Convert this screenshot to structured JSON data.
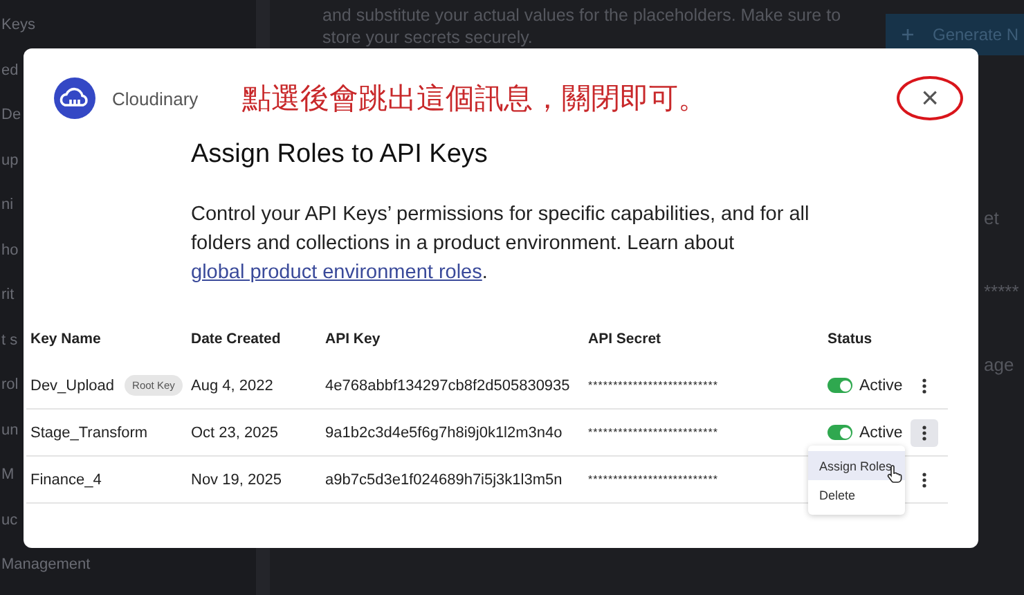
{
  "background": {
    "sidebar": [
      "Keys",
      "ed",
      "De",
      "up",
      "ni",
      "ho",
      "rit",
      "t s",
      "rol",
      "un",
      "M",
      "uc",
      "Management"
    ],
    "notice": [
      "and substitute your actual values for the placeholders. Make sure to",
      "store your secrets securely."
    ],
    "generate_button": "Generate N",
    "right_fragments": [
      "et",
      "*****",
      "age"
    ]
  },
  "dialog": {
    "brand": "Cloudinary",
    "annotation": "點選後會跳出這個訊息，關閉即可。",
    "close": "×",
    "close_circled": true,
    "title": "Assign Roles to API Keys",
    "description": "Control your API Keys’ permissions for specific capabilities, and for all folders and collections in a product environment. Learn about ",
    "link": "global product environment roles",
    "after_link": ".",
    "table": {
      "columns": [
        "Key Name",
        "Date Created",
        "API Key",
        "API Secret",
        "Status"
      ],
      "rows": [
        {
          "name": "Dev_Upload",
          "badge": "Root Key",
          "date": "Aug 4, 2022",
          "key": "4e768abbf134297cb8f2d505830935",
          "secret": "**************************",
          "status": {
            "on": true,
            "label": "Active"
          },
          "menu_open": false
        },
        {
          "name": "Stage_Transform",
          "date": "Oct 23, 2025",
          "key": "9a1b2c3d4e5f6g7h8i9j0k1l2m3n4o",
          "secret": "**************************",
          "status": {
            "on": true,
            "label": "Active"
          },
          "menu_open": true
        },
        {
          "name": "Finance_4",
          "date": "Nov 19, 2025",
          "key": "a9b7c5d3e1f024689h7i5j3k1l3m5n",
          "secret": "**************************",
          "menu_open": false
        }
      ]
    },
    "context_menu": {
      "items": [
        {
          "label": "Assign Roles",
          "selected": true
        },
        {
          "label": "Delete",
          "selected": false
        }
      ]
    }
  }
}
